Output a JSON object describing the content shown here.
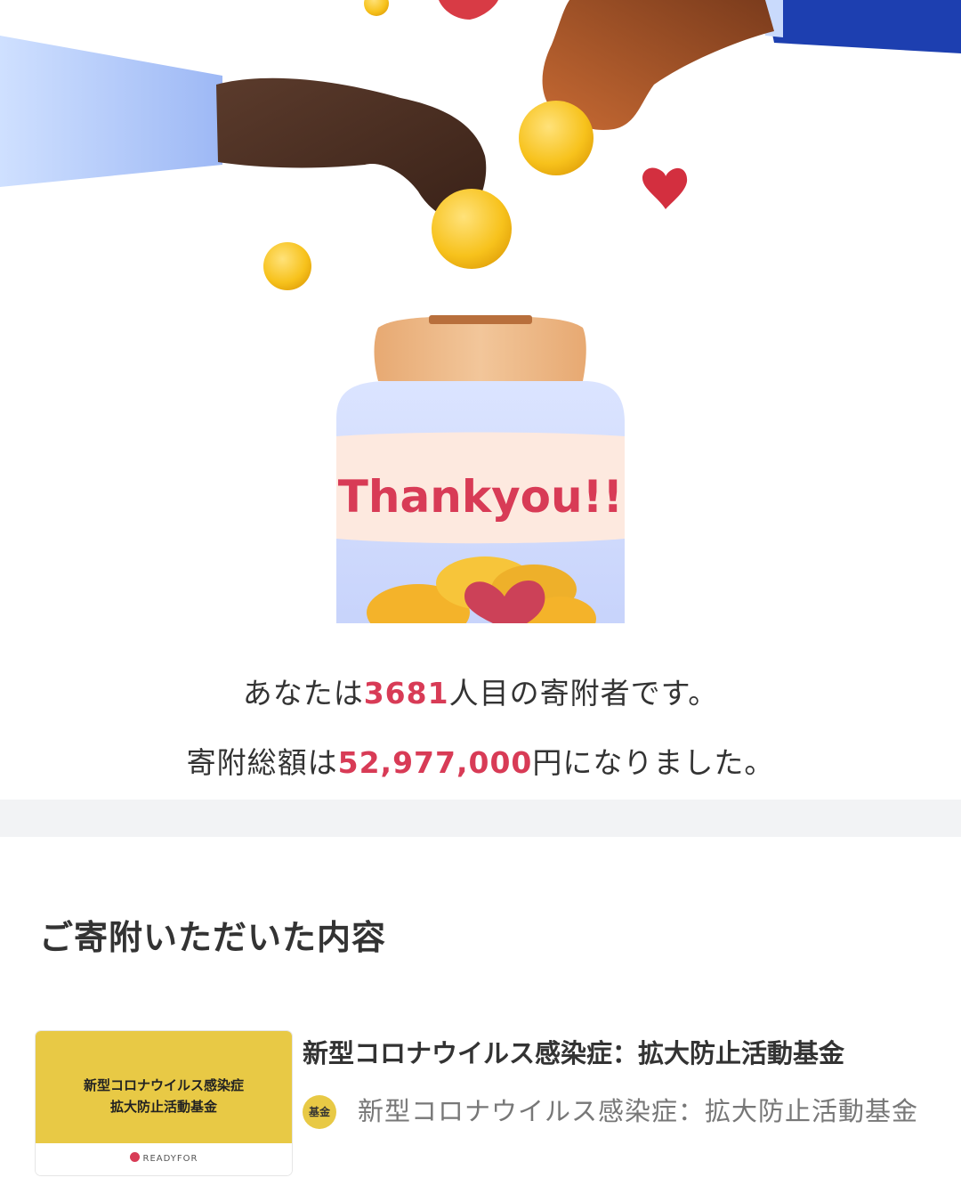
{
  "jar_label": "Thankyou!!",
  "stats": {
    "line1_prefix": "あなたは",
    "donor_number": "3681",
    "line1_suffix": "人目の寄附者です。",
    "line2_prefix": "寄附総額は",
    "total_amount": "52,977,000",
    "line2_suffix": "円になりました。"
  },
  "section_heading": "ご寄附いただいた内容",
  "card": {
    "line1": "新型コロナウイルス感染症",
    "line2": "拡大防止活動基金",
    "brand": "READYFOR"
  },
  "project_title": "新型コロナウイルス感染症：拡大防止活動基金",
  "badge_label": "基金",
  "fund_name": "新型コロナウイルス感染症：拡大防止活動基金",
  "colors": {
    "accent": "#d83b56",
    "gold": "#e8c945",
    "divider": "#f2f3f5"
  }
}
